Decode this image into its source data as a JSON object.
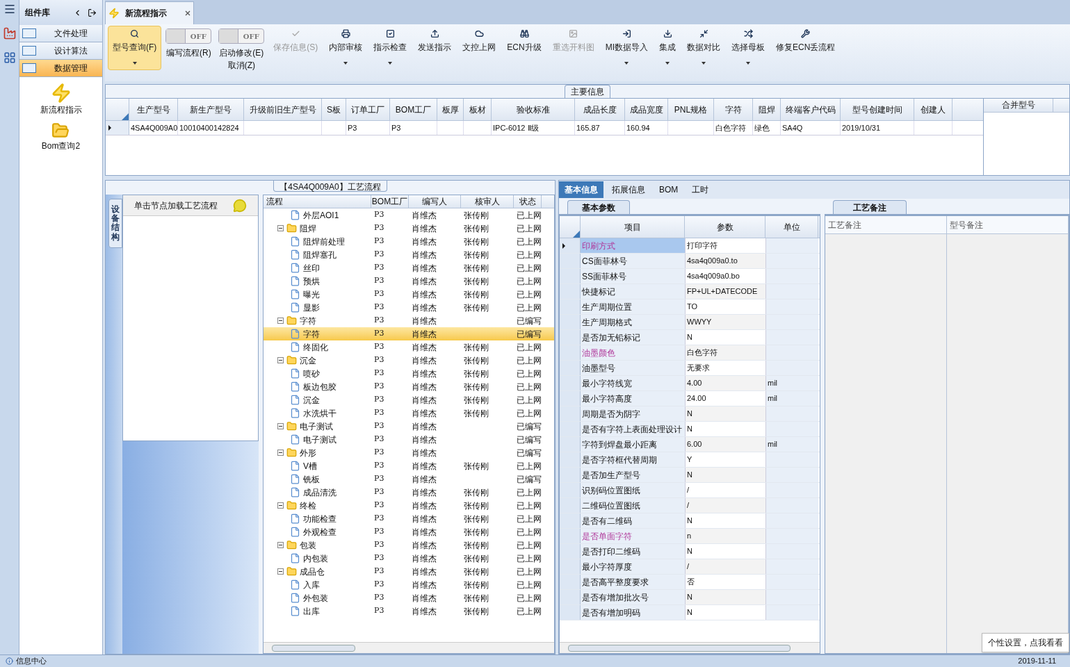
{
  "sidebar": {
    "title": "组件库",
    "items": [
      {
        "label": "文件处理",
        "selected": false
      },
      {
        "label": "设计算法",
        "selected": false
      },
      {
        "label": "数据管理",
        "selected": true
      }
    ],
    "launchers": [
      {
        "label": "新流程指示",
        "kind": "bolt"
      },
      {
        "label": "Bom查询2",
        "kind": "folder"
      }
    ]
  },
  "document_tab": {
    "title": "新流程指示"
  },
  "toolbar": [
    {
      "kind": "button",
      "label": "型号查询(F)",
      "selected": true,
      "dropdown": true,
      "disabled": false
    },
    {
      "kind": "toggle",
      "toggle": "OFF",
      "label": "编写流程(R)",
      "on": false
    },
    {
      "kind": "toggle",
      "toggle": "OFF",
      "label": "启动修改(E)",
      "label2": "取消(Z)",
      "on": false
    },
    {
      "kind": "button",
      "label": "保存信息(S)",
      "selected": false,
      "dropdown": false,
      "disabled": true
    },
    {
      "kind": "button",
      "label": "内部审核",
      "selected": false,
      "dropdown": true,
      "disabled": false
    },
    {
      "kind": "button",
      "label": "指示检查",
      "selected": false,
      "dropdown": true,
      "disabled": false
    },
    {
      "kind": "button",
      "label": "发送指示",
      "selected": false,
      "dropdown": false,
      "disabled": false
    },
    {
      "kind": "button",
      "label": "文控上网",
      "selected": false,
      "dropdown": false,
      "disabled": false
    },
    {
      "kind": "button",
      "label": "ECN升级",
      "selected": false,
      "dropdown": false,
      "disabled": false
    },
    {
      "kind": "button",
      "label": "重选开料图",
      "selected": false,
      "dropdown": false,
      "disabled": true
    },
    {
      "kind": "button",
      "label": "MI数据导入",
      "selected": false,
      "dropdown": true,
      "disabled": false
    },
    {
      "kind": "button",
      "label": "集成",
      "selected": false,
      "dropdown": true,
      "disabled": false
    },
    {
      "kind": "button",
      "label": "数据对比",
      "selected": false,
      "dropdown": true,
      "disabled": false
    },
    {
      "kind": "button",
      "label": "选择母板",
      "selected": false,
      "dropdown": true,
      "disabled": false
    },
    {
      "kind": "button",
      "label": "修复ECN丢流程",
      "selected": false,
      "dropdown": false,
      "disabled": false
    }
  ],
  "main_info": {
    "title": "主要信息",
    "columns": [
      "生产型号",
      "新生产型号",
      "升级前旧生产型号",
      "S板",
      "订单工厂",
      "BOM工厂",
      "板厚",
      "板材",
      "验收标准",
      "成品长度",
      "成品宽度",
      "PNL规格",
      "字符",
      "阻焊",
      "终端客户代码",
      "型号创建时间",
      "创建人"
    ],
    "rows": [
      {
        "selected": true,
        "cells": [
          "4SA4Q009A0",
          "10010400142824",
          null,
          null,
          "P3",
          "P3",
          null,
          null,
          "IPC-6012 Ⅱ级",
          "165.87",
          "160.94",
          null,
          "白色字符",
          "绿色",
          "SA4Q",
          "2019/10/31",
          null
        ]
      }
    ],
    "side_column": "合并型号"
  },
  "process": {
    "title": "【4SA4Q009A0】工艺流程",
    "side_tab": "设备结构",
    "hint": "单击节点加载工艺流程",
    "columns": [
      "流程",
      "BOM工厂",
      "编写人",
      "核审人",
      "状态"
    ],
    "rows": [
      {
        "kind": "leaf",
        "name": "外层AOI1",
        "bom": "P3",
        "author": "肖维杰",
        "reviewer": "张传刚",
        "status": "已上网",
        "selected": false
      },
      {
        "kind": "folder",
        "name": "阻焊",
        "bom": "P3",
        "author": "肖维杰",
        "reviewer": "张传刚",
        "status": "已上网",
        "selected": false,
        "expanded": true,
        "children": [
          {
            "kind": "leaf",
            "name": "阻焊前处理",
            "bom": "P3",
            "author": "肖维杰",
            "reviewer": "张传刚",
            "status": "已上网",
            "selected": false
          },
          {
            "kind": "leaf",
            "name": "阻焊塞孔",
            "bom": "P3",
            "author": "肖维杰",
            "reviewer": "张传刚",
            "status": "已上网",
            "selected": false
          },
          {
            "kind": "leaf",
            "name": "丝印",
            "bom": "P3",
            "author": "肖维杰",
            "reviewer": "张传刚",
            "status": "已上网",
            "selected": false
          },
          {
            "kind": "leaf",
            "name": "预烘",
            "bom": "P3",
            "author": "肖维杰",
            "reviewer": "张传刚",
            "status": "已上网",
            "selected": false
          },
          {
            "kind": "leaf",
            "name": "曝光",
            "bom": "P3",
            "author": "肖维杰",
            "reviewer": "张传刚",
            "status": "已上网",
            "selected": false
          },
          {
            "kind": "leaf",
            "name": "显影",
            "bom": "P3",
            "author": "肖维杰",
            "reviewer": "张传刚",
            "status": "已上网",
            "selected": false
          }
        ]
      },
      {
        "kind": "folder",
        "name": "字符",
        "bom": "P3",
        "author": "肖维杰",
        "status": "已编写",
        "selected": false,
        "expanded": true,
        "children": [
          {
            "kind": "leaf",
            "name": "字符",
            "bom": "P3",
            "author": "肖维杰",
            "status": "已编写",
            "selected": true
          },
          {
            "kind": "leaf",
            "name": "终固化",
            "bom": "P3",
            "author": "肖维杰",
            "reviewer": "张传刚",
            "status": "已上网",
            "selected": false
          }
        ]
      },
      {
        "kind": "folder",
        "name": "沉金",
        "bom": "P3",
        "author": "肖维杰",
        "reviewer": "张传刚",
        "status": "已上网",
        "selected": false,
        "expanded": true,
        "children": [
          {
            "kind": "leaf",
            "name": "喷砂",
            "bom": "P3",
            "author": "肖维杰",
            "reviewer": "张传刚",
            "status": "已上网",
            "selected": false
          },
          {
            "kind": "leaf",
            "name": "板边包胶",
            "bom": "P3",
            "author": "肖维杰",
            "reviewer": "张传刚",
            "status": "已上网",
            "selected": false
          },
          {
            "kind": "leaf",
            "name": "沉金",
            "bom": "P3",
            "author": "肖维杰",
            "reviewer": "张传刚",
            "status": "已上网",
            "selected": false
          },
          {
            "kind": "leaf",
            "name": "水洗烘干",
            "bom": "P3",
            "author": "肖维杰",
            "reviewer": "张传刚",
            "status": "已上网",
            "selected": false
          }
        ]
      },
      {
        "kind": "folder",
        "name": "电子测试",
        "bom": "P3",
        "author": "肖维杰",
        "status": "已编写",
        "selected": false,
        "expanded": true,
        "children": [
          {
            "kind": "leaf",
            "name": "电子测试",
            "bom": "P3",
            "author": "肖维杰",
            "status": "已编写",
            "selected": false
          }
        ]
      },
      {
        "kind": "folder",
        "name": "外形",
        "bom": "P3",
        "author": "肖维杰",
        "status": "已编写",
        "selected": false,
        "expanded": true,
        "children": [
          {
            "kind": "leaf",
            "name": "V槽",
            "bom": "P3",
            "author": "肖维杰",
            "reviewer": "张传刚",
            "status": "已上网",
            "selected": false
          },
          {
            "kind": "leaf",
            "name": "铣板",
            "bom": "P3",
            "author": "肖维杰",
            "status": "已编写",
            "selected": false
          },
          {
            "kind": "leaf",
            "name": "成品清洗",
            "bom": "P3",
            "author": "肖维杰",
            "reviewer": "张传刚",
            "status": "已上网",
            "selected": false
          }
        ]
      },
      {
        "kind": "folder",
        "name": "终检",
        "bom": "P3",
        "author": "肖维杰",
        "reviewer": "张传刚",
        "status": "已上网",
        "selected": false,
        "expanded": true,
        "children": [
          {
            "kind": "leaf",
            "name": "功能检查",
            "bom": "P3",
            "author": "肖维杰",
            "reviewer": "张传刚",
            "status": "已上网",
            "selected": false
          },
          {
            "kind": "leaf",
            "name": "外观检查",
            "bom": "P3",
            "author": "肖维杰",
            "reviewer": "张传刚",
            "status": "已上网",
            "selected": false
          }
        ]
      },
      {
        "kind": "folder",
        "name": "包装",
        "bom": "P3",
        "author": "肖维杰",
        "reviewer": "张传刚",
        "status": "已上网",
        "selected": false,
        "expanded": true,
        "children": [
          {
            "kind": "leaf",
            "name": "内包装",
            "bom": "P3",
            "author": "肖维杰",
            "reviewer": "张传刚",
            "status": "已上网",
            "selected": false
          }
        ]
      },
      {
        "kind": "folder",
        "name": "成品仓",
        "bom": "P3",
        "author": "肖维杰",
        "reviewer": "张传刚",
        "status": "已上网",
        "selected": false,
        "expanded": true,
        "children": [
          {
            "kind": "leaf",
            "name": "入库",
            "bom": "P3",
            "author": "肖维杰",
            "reviewer": "张传刚",
            "status": "已上网",
            "selected": false
          },
          {
            "kind": "leaf",
            "name": "外包装",
            "bom": "P3",
            "author": "肖维杰",
            "reviewer": "张传刚",
            "status": "已上网",
            "selected": false
          },
          {
            "kind": "leaf",
            "name": "出库",
            "bom": "P3",
            "author": "肖维杰",
            "reviewer": "张传刚",
            "status": "已上网",
            "selected": false
          }
        ]
      }
    ]
  },
  "detail_tabs": [
    {
      "label": "基本信息",
      "selected": true
    },
    {
      "label": "拓展信息",
      "selected": false
    },
    {
      "label": "BOM",
      "selected": false
    },
    {
      "label": "工时",
      "selected": false
    }
  ],
  "params": {
    "title": "基本参数",
    "columns": [
      "项目",
      "参数",
      "单位"
    ],
    "rows": [
      {
        "item": "印刷方式",
        "value": "打印字符",
        "highlight": true,
        "selected": true
      },
      {
        "item": "CS面菲林号",
        "value": "4sa4q009a0.to",
        "highlight": false,
        "selected": false
      },
      {
        "item": "SS面菲林号",
        "value": "4sa4q009a0.bo",
        "highlight": false,
        "selected": false
      },
      {
        "item": "快捷标记",
        "value": "FP+UL+DATECODE",
        "highlight": false,
        "selected": false
      },
      {
        "item": "生产周期位置",
        "value": "TO",
        "highlight": false,
        "selected": false
      },
      {
        "item": "生产周期格式",
        "value": "WWYY",
        "highlight": false,
        "selected": false
      },
      {
        "item": "是否加无铅标记",
        "value": "N",
        "highlight": false,
        "selected": false
      },
      {
        "item": "油墨颜色",
        "value": "白色字符",
        "highlight": true,
        "selected": false
      },
      {
        "item": "油墨型号",
        "value": "无要求",
        "highlight": false,
        "selected": false
      },
      {
        "item": "最小字符线宽",
        "value": "4.00",
        "unit": "mil",
        "highlight": false,
        "selected": false
      },
      {
        "item": "最小字符高度",
        "value": "24.00",
        "unit": "mil",
        "highlight": false,
        "selected": false
      },
      {
        "item": "周期是否为阴字",
        "value": "N",
        "highlight": false,
        "selected": false
      },
      {
        "item": "是否有字符上表面处理设计",
        "value": "N",
        "highlight": false,
        "selected": false
      },
      {
        "item": "字符到焊盘最小距离",
        "value": "6.00",
        "unit": "mil",
        "highlight": false,
        "selected": false
      },
      {
        "item": "是否字符框代替周期",
        "value": "Y",
        "highlight": false,
        "selected": false
      },
      {
        "item": "是否加生产型号",
        "value": "N",
        "highlight": false,
        "selected": false
      },
      {
        "item": "识别码位置图纸",
        "value": "/",
        "highlight": false,
        "selected": false
      },
      {
        "item": "二维码位置图纸",
        "value": "/",
        "highlight": false,
        "selected": false
      },
      {
        "item": "是否有二维码",
        "value": "N",
        "highlight": false,
        "selected": false
      },
      {
        "item": "是否单面字符",
        "value": "n",
        "highlight": true,
        "selected": false
      },
      {
        "item": "是否打印二维码",
        "value": "N",
        "highlight": false,
        "selected": false
      },
      {
        "item": "最小字符厚度",
        "value": "/",
        "highlight": false,
        "selected": false
      },
      {
        "item": "是否高平整度要求",
        "value": "否",
        "highlight": false,
        "selected": false
      },
      {
        "item": "是否有增加批次号",
        "value": "N",
        "highlight": false,
        "selected": false
      },
      {
        "item": "是否有增加明码",
        "value": "N",
        "highlight": false,
        "selected": false
      }
    ]
  },
  "notes": {
    "title": "工艺备注",
    "columns": [
      "工艺备注",
      "型号备注"
    ]
  },
  "tooltip": "个性设置，点我看看",
  "status_bar": {
    "left": "信息中心",
    "right": "2019-11-11"
  }
}
